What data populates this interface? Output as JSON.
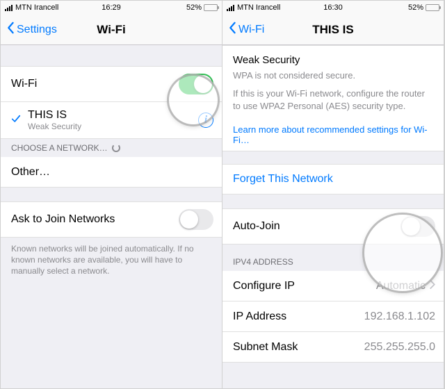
{
  "left": {
    "status": {
      "carrier": "MTN Irancell",
      "time": "16:29",
      "battery_pct": "52%"
    },
    "nav": {
      "back": "Settings",
      "title": "Wi-Fi"
    },
    "wifi_toggle_label": "Wi-Fi",
    "connected": {
      "ssid": "THIS IS",
      "subtitle": "Weak Security"
    },
    "choose_header": "Choose a Network…",
    "other_label": "Other…",
    "ask_label": "Ask to Join Networks",
    "ask_footer": "Known networks will be joined automatically. If no known networks are available, you will have to manually select a network.",
    "info_glyph": "i"
  },
  "right": {
    "status": {
      "carrier": "MTN Irancell",
      "time": "16:30",
      "battery_pct": "52%"
    },
    "nav": {
      "back": "Wi-Fi",
      "title": "THIS IS"
    },
    "weak_title": "Weak Security",
    "weak_line1": "WPA is not considered secure.",
    "weak_line2": "If this is your Wi-Fi network, configure the router to use WPA2 Personal (AES) security type.",
    "learn_more": "Learn more about recommended settings for Wi-Fi…",
    "forget": "Forget This Network",
    "auto_join": "Auto-Join",
    "ipv4_header": "IPv4 Address",
    "configure_ip_label": "Configure IP",
    "configure_ip_value": "Automatic",
    "ip_label": "IP Address",
    "ip_value": "192.168.1.102",
    "subnet_label": "Subnet Mask",
    "subnet_value": "255.255.255.0"
  }
}
